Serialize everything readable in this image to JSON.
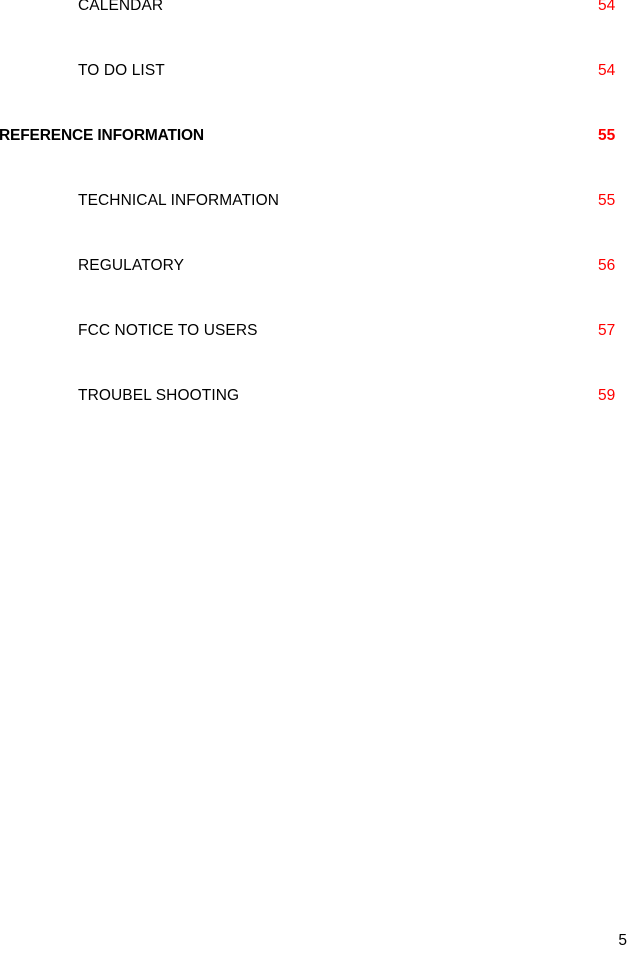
{
  "document": {
    "type": "table-of-contents",
    "accent_color": "#ff0000",
    "text_color": "#000000",
    "background_color": "#ffffff"
  },
  "toc": {
    "entries": [
      {
        "title": "CALENDAR",
        "page": "54",
        "level": 1
      },
      {
        "title": "TO DO LIST",
        "page": "54",
        "level": 1
      },
      {
        "title": "REFERENCE INFORMATION",
        "page": "55",
        "level": 0
      },
      {
        "title": "TECHNICAL INFORMATION",
        "page": "55",
        "level": 1
      },
      {
        "title": "REGULATORY",
        "page": "56",
        "level": 1
      },
      {
        "title": "FCC NOTICE TO USERS",
        "page": "57",
        "level": 1
      },
      {
        "title": "TROUBEL SHOOTING",
        "page": "59",
        "level": 1
      }
    ]
  },
  "footer": {
    "page_number": "5"
  }
}
